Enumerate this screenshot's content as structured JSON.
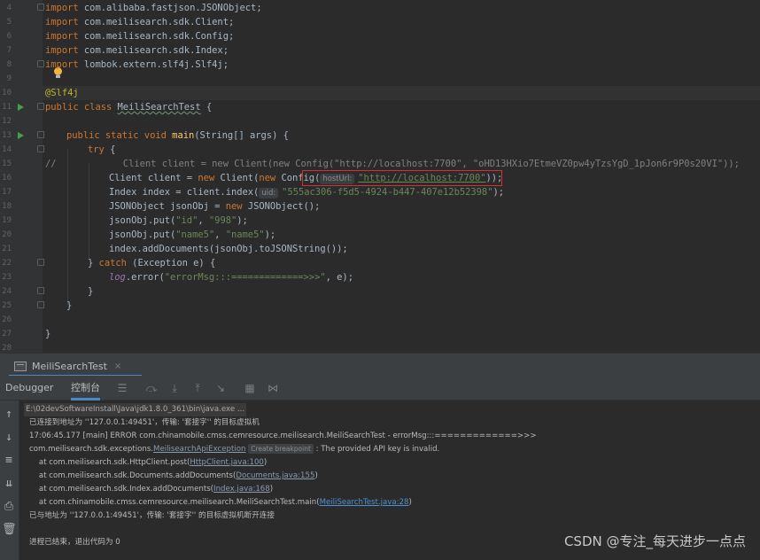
{
  "editor": {
    "line_numbers": [
      "4",
      "5",
      "6",
      "7",
      "8",
      "9",
      "10",
      "11",
      "12",
      "13",
      "14",
      "15",
      "16",
      "17",
      "18",
      "19",
      "20",
      "21",
      "22",
      "23",
      "24",
      "25",
      "26",
      "27",
      "28"
    ],
    "imports": {
      "kw": "import",
      "l4": " com.alibaba.fastjson.JSONObject;",
      "l5": " com.meilisearch.sdk.Client;",
      "l6": " com.meilisearch.sdk.Config;",
      "l7": " com.meilisearch.sdk.Index;",
      "l8": " lombok.extern.slf4j.Slf4j;"
    },
    "annotation": "@Slf4j",
    "class_decl": {
      "kw": "public class ",
      "name": "MeiliSearchTest",
      "rest": " {"
    },
    "main_decl": {
      "kw": "public static void ",
      "name": "main",
      "rest": "(String[] args) {"
    },
    "try_kw": "try",
    "try_rest": " {",
    "comment_line": "//            Client client = new Client(new Config(\"http://localhost:7700\", \"oHD13HXio7EtmeVZ0pw4yTzsYgD_1pJon6r9P0s20VI\"));",
    "client_line": {
      "a": "Client client = ",
      "kw": "new ",
      "b": "Client(",
      "kw2": "new ",
      "c": "Config(",
      "hint": "hostUrl:",
      "str": "\"http://localhost:7700\"",
      "d": "));"
    },
    "index_line": {
      "a": "Index index = client.index(",
      "hint": "uid:",
      "str": "\"555ac306-f5d5-4924-b447-407e12b52398\"",
      "b": ");"
    },
    "json_line": {
      "a": "JSONObject jsonObj = ",
      "kw": "new ",
      "b": "JSONObject();"
    },
    "put1": {
      "a": "jsonObj.put(",
      "s1": "\"id\"",
      "sep": ", ",
      "s2": "\"998\"",
      "b": ");"
    },
    "put2": {
      "a": "jsonObj.put(",
      "s1": "\"name5\"",
      "sep": ", ",
      "s2": "\"name5\"",
      "b": ");"
    },
    "add_docs": "index.addDocuments(jsonObj.toJSONString());",
    "catch_line": {
      "a": "} ",
      "kw": "catch",
      "b": " (Exception e) {"
    },
    "log_line": {
      "fld": "log",
      "a": ".error(",
      "str": "\"errorMsg:::=============>>>\"",
      "b": ", e);"
    },
    "brace": "}"
  },
  "run_window": {
    "tab_label": "MeiliSearchTest",
    "tab_close": "×",
    "tabs": {
      "debugger": "Debugger",
      "console": "控制台"
    }
  },
  "console": {
    "l1": "E:\\02devSoftwareInstall\\Java\\jdk1.8.0_361\\bin\\java.exe ...",
    "l2": "已连接到地址为 ''127.0.0.1:49451'，传输: '套接字'' 的目标虚拟机",
    "l3": "17:06:45.177 [main] ERROR com.chinamobile.cmss.cemresource.meilisearch.MeiliSearchTest - errorMsg:::=============>>>",
    "l4": {
      "a": "com.meilisearch.sdk.exceptions.",
      "link": "MeilisearchApiException",
      "bp": "Create breakpoint",
      "b": " : The provided API key is invalid."
    },
    "l5": {
      "a": "    at com.meilisearch.sdk.HttpClient.post(",
      "link": "HttpClient.java:100",
      "b": ")"
    },
    "l6": {
      "a": "    at com.meilisearch.sdk.Documents.addDocuments(",
      "link": "Documents.java:155",
      "b": ")"
    },
    "l7": {
      "a": "    at com.meilisearch.sdk.Index.addDocuments(",
      "link": "Index.java:168",
      "b": ")"
    },
    "l8": {
      "a": "    at com.chinamobile.cmss.cemresource.meilisearch.MeiliSearchTest.main(",
      "link": "MeiliSearchTest.java:28",
      "b": ")"
    },
    "l9": "已与地址为 ''127.0.0.1:49451'，传输: '套接字'' 的目标虚拟机断开连接",
    "l10": "进程已结束，退出代码为 0"
  },
  "watermark": "CSDN @专注_每天进步一点点",
  "icons": [
    "run-icon",
    "fold-icon",
    "bulb-icon",
    "rerun-icon",
    "up-arrow-icon",
    "down-arrow-icon",
    "soft-wrap-icon",
    "scroll-end-icon",
    "print-icon",
    "trash-icon",
    "table-icon",
    "settings-icon"
  ]
}
